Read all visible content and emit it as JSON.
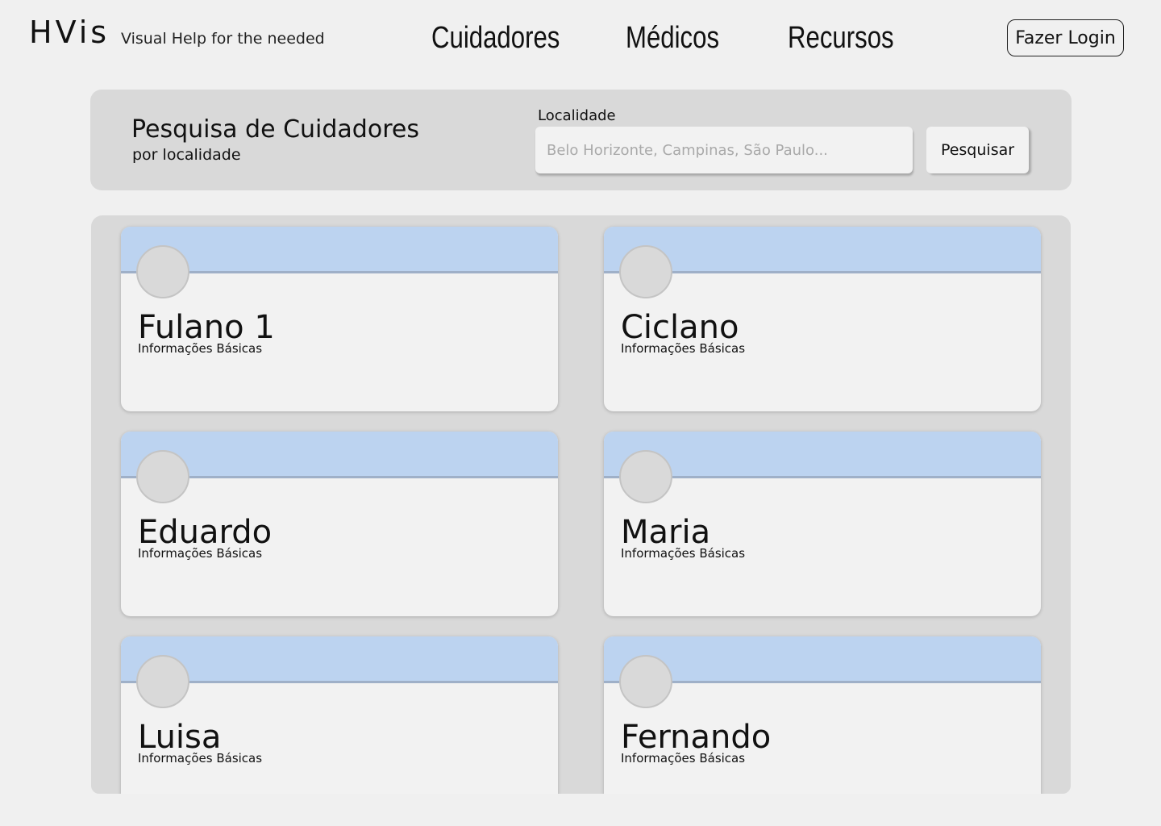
{
  "header": {
    "brand": "HVis",
    "tagline": "Visual Help for the needed",
    "nav": [
      "Cuidadores",
      "Médicos",
      "Recursos"
    ],
    "login_label": "Fazer Login"
  },
  "search": {
    "title": "Pesquisa de Cuidadores",
    "subtitle": "por localidade",
    "location_label": "Localidade",
    "location_placeholder": "Belo Horizonte, Campinas, São Paulo...",
    "location_value": "",
    "button_label": "Pesquisar"
  },
  "results": {
    "cards": [
      {
        "name": "Fulano 1",
        "info": "Informações Básicas"
      },
      {
        "name": "Ciclano",
        "info": "Informações Básicas"
      },
      {
        "name": "Eduardo",
        "info": "Informações Básicas"
      },
      {
        "name": "Maria",
        "info": "Informações Básicas"
      },
      {
        "name": "Luisa",
        "info": "Informações Básicas"
      },
      {
        "name": "Fernando",
        "info": "Informações Básicas"
      }
    ]
  },
  "colors": {
    "page_background": "#f0f0f0",
    "panel_background": "#d9d9d9",
    "card_background": "#f2f2f2",
    "card_banner": "#bcd3f0"
  }
}
